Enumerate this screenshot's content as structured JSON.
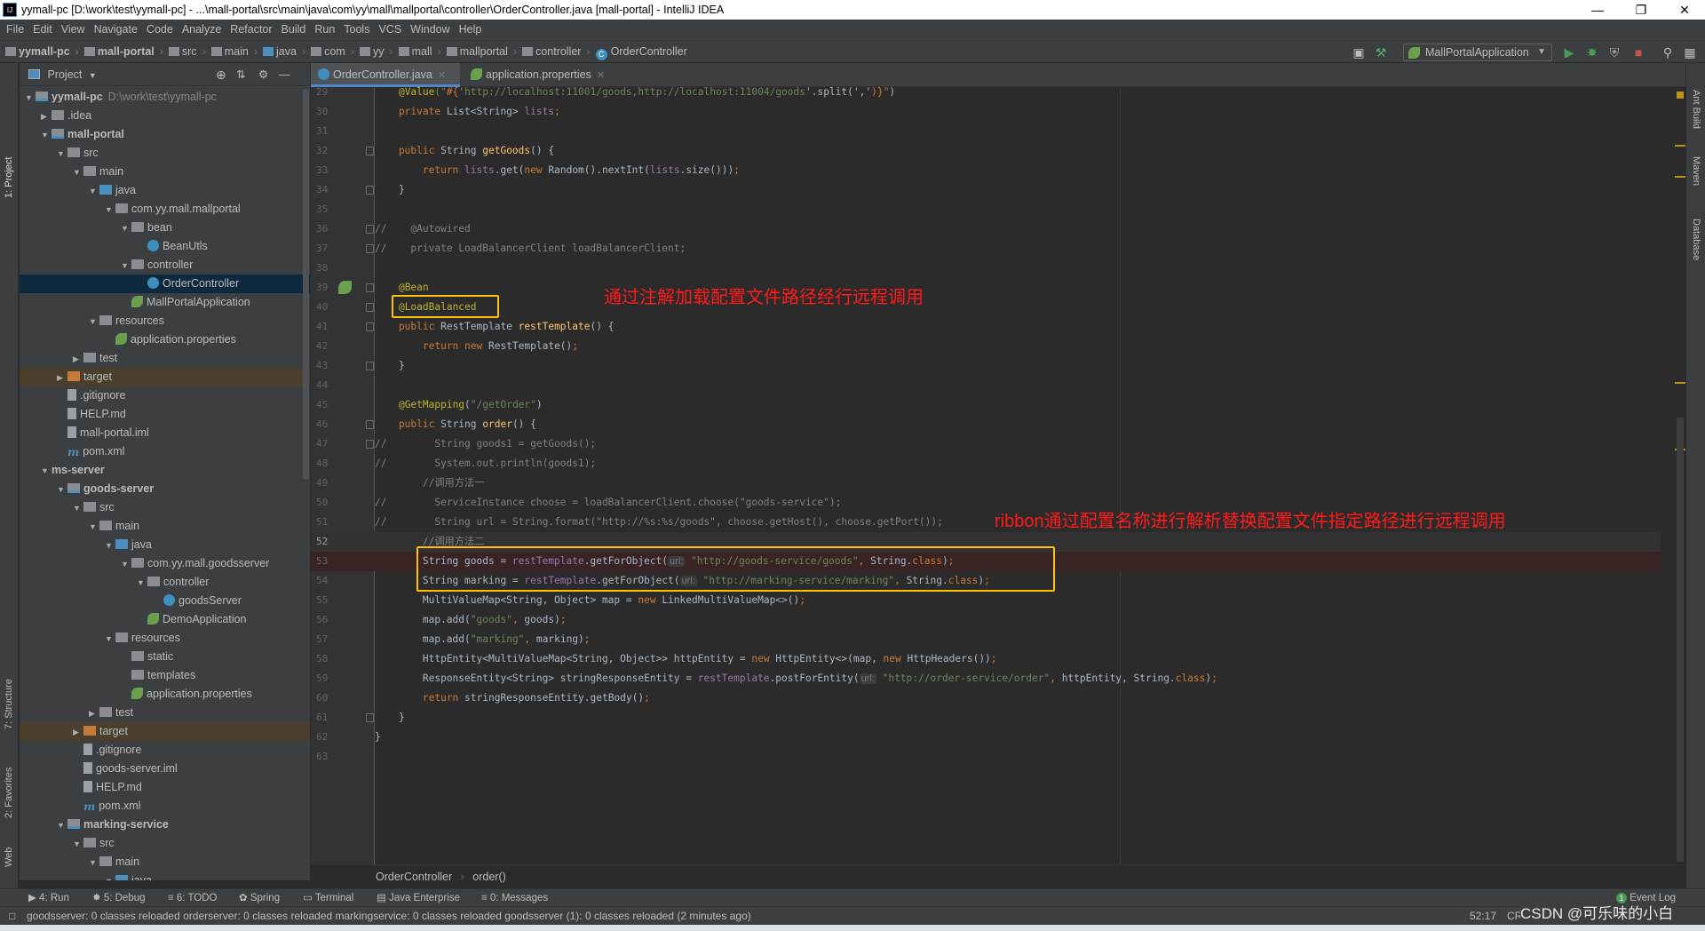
{
  "window": {
    "title": "yymall-pc [D:\\work\\test\\yymall-pc] - ...\\mall-portal\\src\\main\\java\\com\\yy\\mall\\mallportal\\controller\\OrderController.java [mall-portal] - IntelliJ IDEA",
    "logo": "IJ"
  },
  "menu": [
    "File",
    "Edit",
    "View",
    "Navigate",
    "Code",
    "Analyze",
    "Refactor",
    "Build",
    "Run",
    "Tools",
    "VCS",
    "Window",
    "Help"
  ],
  "nav_breadcrumb": [
    {
      "label": "yymall-pc",
      "bold": true
    },
    {
      "label": "mall-portal",
      "bold": true
    },
    {
      "label": "src"
    },
    {
      "label": "main"
    },
    {
      "label": "java"
    },
    {
      "label": "com"
    },
    {
      "label": "yy"
    },
    {
      "label": "mall"
    },
    {
      "label": "mallportal"
    },
    {
      "label": "controller"
    },
    {
      "label": "OrderController",
      "icon": "class-icon"
    }
  ],
  "toolbar": {
    "run_config": "MallPortalApplication"
  },
  "project_panel": {
    "title": "Project",
    "tree": [
      {
        "label": "yymall-pc",
        "sub": "D:\\work\\test\\yymall-pc",
        "level": 0,
        "arrow": "down",
        "icon": "module",
        "bold": true
      },
      {
        "label": ".idea",
        "level": 1,
        "arrow": "right",
        "icon": "folder"
      },
      {
        "label": "mall-portal",
        "level": 1,
        "arrow": "down",
        "icon": "module",
        "bold": true
      },
      {
        "label": "src",
        "level": 2,
        "arrow": "down",
        "icon": "folder"
      },
      {
        "label": "main",
        "level": 3,
        "arrow": "down",
        "icon": "folder"
      },
      {
        "label": "java",
        "level": 4,
        "arrow": "down",
        "icon": "src"
      },
      {
        "label": "com.yy.mall.mallportal",
        "level": 5,
        "arrow": "down",
        "icon": "pkg"
      },
      {
        "label": "bean",
        "level": 6,
        "arrow": "down",
        "icon": "pkg"
      },
      {
        "label": "BeanUtls",
        "level": 7,
        "icon": "cls"
      },
      {
        "label": "controller",
        "level": 6,
        "arrow": "down",
        "icon": "pkg"
      },
      {
        "label": "OrderController",
        "level": 7,
        "icon": "cls",
        "selected": true
      },
      {
        "label": "MallPortalApplication",
        "level": 6,
        "icon": "sp"
      },
      {
        "label": "resources",
        "level": 4,
        "arrow": "down",
        "icon": "folder"
      },
      {
        "label": "application.properties",
        "level": 5,
        "icon": "sp"
      },
      {
        "label": "test",
        "level": 3,
        "arrow": "right",
        "icon": "folder"
      },
      {
        "label": "target",
        "level": 2,
        "arrow": "right",
        "icon": "tgt",
        "highlight": true
      },
      {
        "label": ".gitignore",
        "level": 2,
        "icon": "file"
      },
      {
        "label": "HELP.md",
        "level": 2,
        "icon": "file"
      },
      {
        "label": "mall-portal.iml",
        "level": 2,
        "icon": "file"
      },
      {
        "label": "pom.xml",
        "level": 2,
        "icon": "mvn"
      },
      {
        "label": "ms-server",
        "level": 1,
        "arrow": "down",
        "icon": "none",
        "bold": true
      },
      {
        "label": "goods-server",
        "level": 2,
        "arrow": "down",
        "icon": "module",
        "bold": true
      },
      {
        "label": "src",
        "level": 3,
        "arrow": "down",
        "icon": "folder"
      },
      {
        "label": "main",
        "level": 4,
        "arrow": "down",
        "icon": "folder"
      },
      {
        "label": "java",
        "level": 5,
        "arrow": "down",
        "icon": "src"
      },
      {
        "label": "com.yy.mall.goodsserver",
        "level": 6,
        "arrow": "down",
        "icon": "pkg"
      },
      {
        "label": "controller",
        "level": 7,
        "arrow": "down",
        "icon": "pkg"
      },
      {
        "label": "goodsServer",
        "level": 8,
        "icon": "cls"
      },
      {
        "label": "DemoApplication",
        "level": 7,
        "icon": "sp"
      },
      {
        "label": "resources",
        "level": 5,
        "arrow": "down",
        "icon": "folder"
      },
      {
        "label": "static",
        "level": 6,
        "icon": "folder"
      },
      {
        "label": "templates",
        "level": 6,
        "icon": "folder"
      },
      {
        "label": "application.properties",
        "level": 6,
        "icon": "sp"
      },
      {
        "label": "test",
        "level": 4,
        "arrow": "right",
        "icon": "folder"
      },
      {
        "label": "target",
        "level": 3,
        "arrow": "right",
        "icon": "tgt",
        "highlight": true
      },
      {
        "label": ".gitignore",
        "level": 3,
        "icon": "file"
      },
      {
        "label": "goods-server.iml",
        "level": 3,
        "icon": "file"
      },
      {
        "label": "HELP.md",
        "level": 3,
        "icon": "file"
      },
      {
        "label": "pom.xml",
        "level": 3,
        "icon": "mvn"
      },
      {
        "label": "marking-service",
        "level": 2,
        "arrow": "down",
        "icon": "module",
        "bold": true
      },
      {
        "label": "src",
        "level": 3,
        "arrow": "down",
        "icon": "folder"
      },
      {
        "label": "main",
        "level": 4,
        "arrow": "down",
        "icon": "folder"
      },
      {
        "label": "java",
        "level": 5,
        "arrow": "down",
        "icon": "src"
      }
    ]
  },
  "tabs": [
    {
      "label": "OrderController.java",
      "active": true,
      "icon": "class-icon"
    },
    {
      "label": "application.properties",
      "icon": "spring-icon"
    }
  ],
  "editor": {
    "current_line": 52,
    "breakpoint_line": 53,
    "bean_gutter_line": 39,
    "fold_lines": [
      32,
      34,
      36,
      37,
      39,
      40,
      41,
      43,
      46,
      47,
      52,
      61
    ],
    "lines": [
      {
        "n": 29,
        "t": [
          [
            "    ",
            "d"
          ],
          [
            "@Value",
            "a"
          ],
          [
            "(\"",
            "s"
          ],
          [
            "#{'",
            "k"
          ],
          [
            "http://localhost:11001/goods,http://localhost:11004/goods",
            "s"
          ],
          [
            "'.split(','",
            "d"
          ],
          [
            ")}\"",
            "k"
          ],
          [
            ")",
            "d"
          ]
        ]
      },
      {
        "n": 30,
        "t": [
          [
            "    private ",
            "k"
          ],
          [
            "List<String> ",
            "d"
          ],
          [
            "lists",
            "f"
          ],
          [
            ";",
            "k"
          ]
        ]
      },
      {
        "n": 31,
        "t": []
      },
      {
        "n": 32,
        "t": [
          [
            "    public ",
            "k"
          ],
          [
            "String ",
            "d"
          ],
          [
            "getGoods",
            "m"
          ],
          [
            "() {",
            "d"
          ]
        ]
      },
      {
        "n": 33,
        "t": [
          [
            "        return ",
            "k"
          ],
          [
            "lists",
            "f"
          ],
          [
            ".get(",
            "d"
          ],
          [
            "new ",
            "k"
          ],
          [
            "Random().nextInt(",
            "d"
          ],
          [
            "lists",
            "f"
          ],
          [
            ".size()))",
            "d"
          ],
          [
            ";",
            "k"
          ]
        ]
      },
      {
        "n": 34,
        "t": [
          [
            "    }",
            "d"
          ]
        ]
      },
      {
        "n": 35,
        "t": []
      },
      {
        "n": 36,
        "t": [
          [
            "//    @Autowired",
            "c"
          ]
        ]
      },
      {
        "n": 37,
        "t": [
          [
            "//    private LoadBalancerClient loadBalancerClient;",
            "c"
          ]
        ]
      },
      {
        "n": 38,
        "t": []
      },
      {
        "n": 39,
        "t": [
          [
            "    ",
            "d"
          ],
          [
            "@Bean",
            "a"
          ]
        ]
      },
      {
        "n": 40,
        "t": [
          [
            "    ",
            "d"
          ],
          [
            "@LoadBalanced",
            "a"
          ]
        ]
      },
      {
        "n": 41,
        "t": [
          [
            "    public ",
            "k"
          ],
          [
            "RestTemplate ",
            "d"
          ],
          [
            "restTemplate",
            "m"
          ],
          [
            "() {",
            "d"
          ]
        ]
      },
      {
        "n": 42,
        "t": [
          [
            "        return new ",
            "k"
          ],
          [
            "RestTemplate()",
            "d"
          ],
          [
            ";",
            "k"
          ]
        ]
      },
      {
        "n": 43,
        "t": [
          [
            "    }",
            "d"
          ]
        ]
      },
      {
        "n": 44,
        "t": []
      },
      {
        "n": 45,
        "t": [
          [
            "    ",
            "d"
          ],
          [
            "@GetMapping",
            "a"
          ],
          [
            "(",
            "d"
          ],
          [
            "\"/getOrder\"",
            "s"
          ],
          [
            ")",
            "d"
          ]
        ]
      },
      {
        "n": 46,
        "t": [
          [
            "    public ",
            "k"
          ],
          [
            "String ",
            "d"
          ],
          [
            "order",
            "m"
          ],
          [
            "() {",
            "d"
          ]
        ]
      },
      {
        "n": 47,
        "t": [
          [
            "//        String goods1 = getGoods();",
            "c"
          ]
        ]
      },
      {
        "n": 48,
        "t": [
          [
            "//        System.out.println(goods1);",
            "c"
          ]
        ]
      },
      {
        "n": 49,
        "t": [
          [
            "        //调用方法一",
            "c"
          ]
        ]
      },
      {
        "n": 50,
        "t": [
          [
            "//        ServiceInstance choose = loadBalancerClient.choose(\"goods-service\");",
            "c"
          ]
        ]
      },
      {
        "n": 51,
        "t": [
          [
            "//        String url = String.format(\"http://%s:%s/goods\", choose.getHost(), choose.getPort());",
            "c"
          ]
        ]
      },
      {
        "n": 52,
        "t": [
          [
            "        //调用方法二",
            "c"
          ]
        ]
      },
      {
        "n": 53,
        "t": [
          [
            "        String goods = ",
            "d"
          ],
          [
            "restTemplate",
            "f"
          ],
          [
            ".getForObject(",
            "d"
          ],
          [
            "url:",
            "h"
          ],
          [
            " \"http://goods-service/goods\"",
            "s"
          ],
          [
            ", ",
            "k"
          ],
          [
            "String.",
            "d"
          ],
          [
            "class",
            "k"
          ],
          [
            ")",
            "d"
          ],
          [
            ";",
            "k"
          ]
        ]
      },
      {
        "n": 54,
        "t": [
          [
            "        String marking = ",
            "d"
          ],
          [
            "restTemplate",
            "f"
          ],
          [
            ".getForObject(",
            "d"
          ],
          [
            "url:",
            "h"
          ],
          [
            " \"http://marking-service/marking\"",
            "s"
          ],
          [
            ", ",
            "k"
          ],
          [
            "String.",
            "d"
          ],
          [
            "class",
            "k"
          ],
          [
            ")",
            "d"
          ],
          [
            ";",
            "k"
          ]
        ]
      },
      {
        "n": 55,
        "t": [
          [
            "        MultiValueMap<String, Object> map = ",
            "d"
          ],
          [
            "new ",
            "k"
          ],
          [
            "LinkedMultiValueMap<>()",
            "d"
          ],
          [
            ";",
            "k"
          ]
        ]
      },
      {
        "n": 56,
        "t": [
          [
            "        map.add(",
            "d"
          ],
          [
            "\"goods\"",
            "s"
          ],
          [
            ", ",
            "k"
          ],
          [
            "goods)",
            "d"
          ],
          [
            ";",
            "k"
          ]
        ]
      },
      {
        "n": 57,
        "t": [
          [
            "        map.add(",
            "d"
          ],
          [
            "\"marking\"",
            "s"
          ],
          [
            ", ",
            "k"
          ],
          [
            "marking)",
            "d"
          ],
          [
            ";",
            "k"
          ]
        ]
      },
      {
        "n": 58,
        "t": [
          [
            "        HttpEntity<MultiValueMap<String, Object>> httpEntity = ",
            "d"
          ],
          [
            "new ",
            "k"
          ],
          [
            "HttpEntity<>(map, ",
            "d"
          ],
          [
            "new ",
            "k"
          ],
          [
            "HttpHeaders())",
            "d"
          ],
          [
            ";",
            "k"
          ]
        ]
      },
      {
        "n": 59,
        "t": [
          [
            "        ResponseEntity<String> stringResponseEntity = ",
            "d"
          ],
          [
            "restTemplate",
            "f"
          ],
          [
            ".postForEntity(",
            "d"
          ],
          [
            "url:",
            "h"
          ],
          [
            " \"http://order-service/order\"",
            "s"
          ],
          [
            ", ",
            "k"
          ],
          [
            "httpEntity, String.",
            "d"
          ],
          [
            "class",
            "k"
          ],
          [
            ")",
            "d"
          ],
          [
            ";",
            "k"
          ]
        ]
      },
      {
        "n": 60,
        "t": [
          [
            "        return ",
            "k"
          ],
          [
            "stringResponseEntity.getBody()",
            "d"
          ],
          [
            ";",
            "k"
          ]
        ]
      },
      {
        "n": 61,
        "t": [
          [
            "    }",
            "d"
          ]
        ]
      },
      {
        "n": 62,
        "t": [
          [
            "}",
            "d"
          ]
        ]
      },
      {
        "n": 63,
        "t": []
      }
    ],
    "annotations": [
      {
        "text": "通过注解加载配置文件路径经行远程调用"
      },
      {
        "text": "ribbon通过配置名称进行解析替换配置文件指定路径进行远程调用"
      }
    ],
    "breadcrumb": [
      "OrderController",
      "order()"
    ]
  },
  "left_stripe": [
    "1: Project",
    "7: Structure",
    "2: Favorites",
    "Web"
  ],
  "right_stripe": [
    "Ant Build",
    "Maven",
    "Database"
  ],
  "tool_windows": [
    "4: Run",
    "5: Debug",
    "6: TODO",
    "Spring",
    "Terminal",
    "Java Enterprise",
    "0: Messages"
  ],
  "event_log": {
    "label": "Event Log",
    "count": "1"
  },
  "status": {
    "message": "goodsserver: 0 classes reloaded orderserver: 0 classes reloaded markingservice: 0 classes reloaded goodsserver (1): 0 classes reloaded (2 minutes ago)",
    "position": "52:17",
    "line_sep": "CRLF",
    "watermark": "CSDN @可乐味的小白"
  },
  "colors": {
    "accent": "#4a88c7",
    "highlight_box": "#ffc000",
    "annotation_text": "#ff1a1a",
    "breakpoint": "#c75450"
  }
}
